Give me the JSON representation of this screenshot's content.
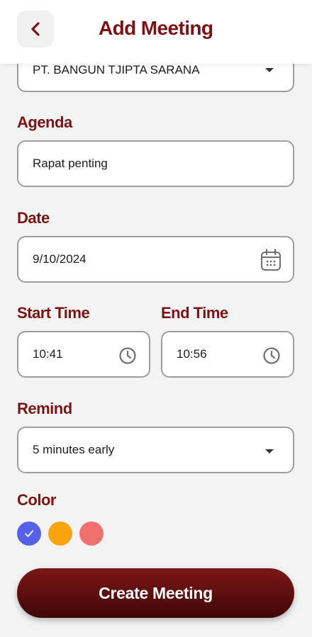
{
  "header": {
    "title": "Add Meeting"
  },
  "company": {
    "selected": "PT. BANGUN TJIPTA SARANA"
  },
  "agenda": {
    "label": "Agenda",
    "value": "Rapat penting"
  },
  "date": {
    "label": "Date",
    "value": "9/10/2024"
  },
  "start_time": {
    "label": "Start Time",
    "value": "10:41"
  },
  "end_time": {
    "label": "End Time",
    "value": "10:56"
  },
  "remind": {
    "label": "Remind",
    "selected": "5 minutes early"
  },
  "color": {
    "label": "Color",
    "options": [
      {
        "hex": "#5461e8",
        "selected": true
      },
      {
        "hex": "#f9a40f",
        "selected": false
      },
      {
        "hex": "#f07070",
        "selected": false
      }
    ]
  },
  "actions": {
    "create_label": "Create Meeting"
  },
  "icons": {
    "back": "chevron-left-icon",
    "calendar": "calendar-icon",
    "clock": "clock-icon",
    "dropdown": "caret-down-icon",
    "check": "check-icon"
  }
}
